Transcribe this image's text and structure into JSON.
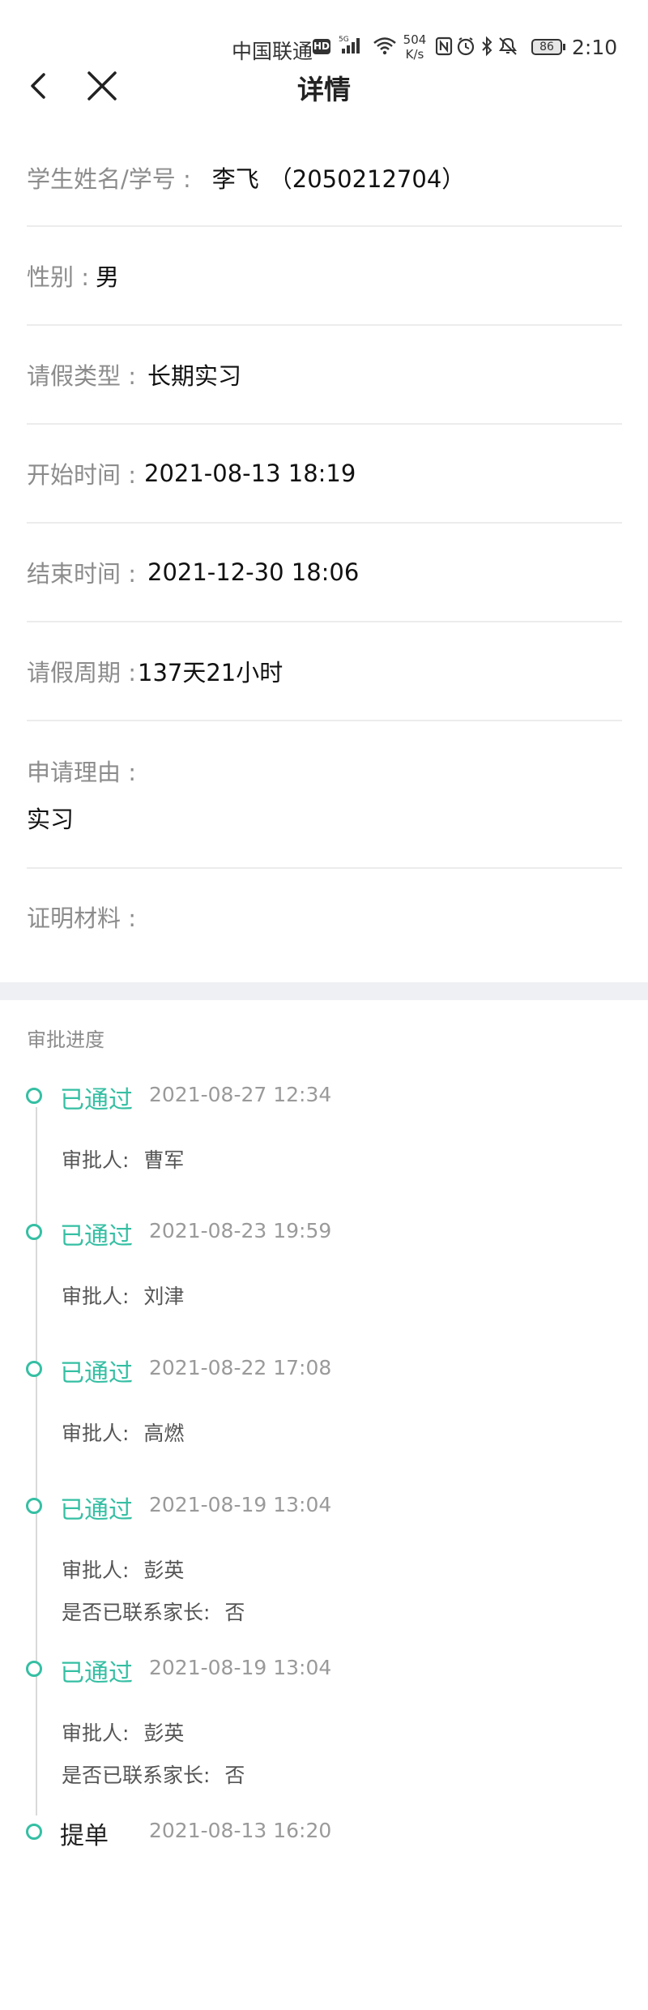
{
  "status_bar": {
    "carrier": "中国联通",
    "hd": "HD",
    "speed_value": "504",
    "speed_unit": "K/s",
    "battery": "86",
    "time": "2:10"
  },
  "nav": {
    "title": "详情"
  },
  "fields": {
    "student": {
      "label": "学生姓名/学号 :",
      "name": "李飞",
      "id": "（2050212704）"
    },
    "gender": {
      "label": "性别 :",
      "value": "男"
    },
    "leave_type": {
      "label": "请假类型 :",
      "value": "长期实习"
    },
    "start_time": {
      "label": "开始时间 :",
      "value": "2021-08-13 18:19"
    },
    "end_time": {
      "label": "结束时间 :",
      "value": "2021-12-30 18:06"
    },
    "period": {
      "label": "请假周期 :",
      "value": "137天21小时"
    },
    "reason": {
      "label": "申请理由 :",
      "value": "实习"
    },
    "proof": {
      "label": "证明材料 :"
    }
  },
  "approval": {
    "title": "审批进度",
    "approver_label": "审批人:",
    "parent_label": "是否已联系家长:",
    "steps": [
      {
        "status": "已通过",
        "time": "2021-08-27 12:34",
        "approver": "曹军"
      },
      {
        "status": "已通过",
        "time": "2021-08-23 19:59",
        "approver": "刘津"
      },
      {
        "status": "已通过",
        "time": "2021-08-22 17:08",
        "approver": "高燃"
      },
      {
        "status": "已通过",
        "time": "2021-08-19 13:04",
        "approver": "彭英",
        "parent_contacted": "否"
      },
      {
        "status": "已通过",
        "time": "2021-08-19 13:04",
        "approver": "彭英",
        "parent_contacted": "否"
      },
      {
        "status": "提单",
        "time": "2021-08-13 16:20"
      }
    ]
  },
  "colors": {
    "accent": "#35bfa3",
    "label": "#8c8c8c",
    "divider": "#ececec",
    "band": "#eef0f3"
  },
  "icons": [
    "back-icon",
    "close-icon",
    "signal-icon",
    "wifi-icon",
    "nfc-icon",
    "alarm-icon",
    "bluetooth-icon",
    "mute-icon",
    "battery-icon"
  ]
}
